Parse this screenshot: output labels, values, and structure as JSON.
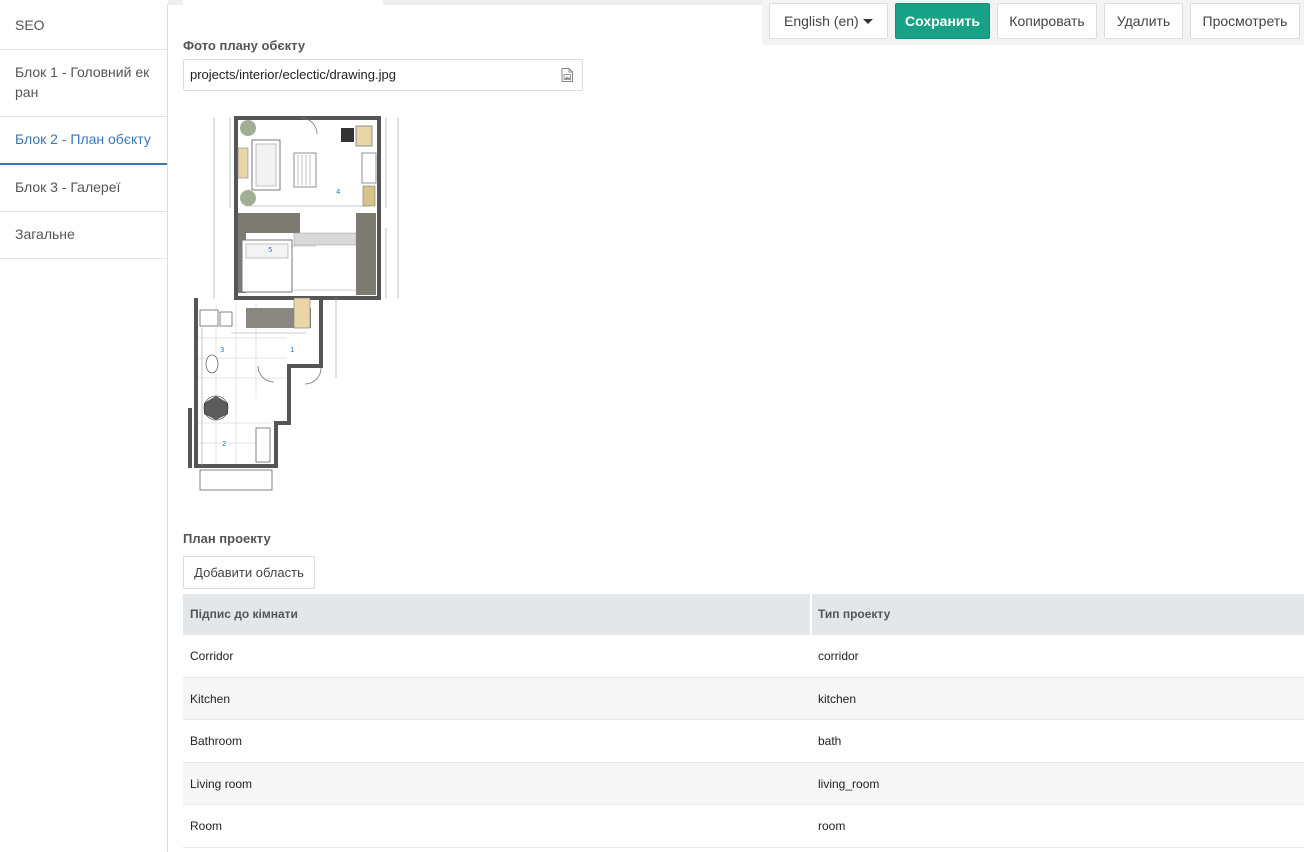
{
  "sidebar": {
    "items": [
      {
        "label": "SEO"
      },
      {
        "label": "Блок 1 - Головний екран"
      },
      {
        "label": "Блок 2 - План обєкту"
      },
      {
        "label": "Блок 3 - Галереї"
      },
      {
        "label": "Загальне"
      }
    ]
  },
  "toolbar": {
    "language": "English (en)",
    "save_label": "Сохранить",
    "copy_label": "Копировать",
    "delete_label": "Удалить",
    "view_label": "Просмотреть"
  },
  "photo": {
    "label": "Фото плану обєкту",
    "file_value": "projects/interior/eclectic/drawing.jpg",
    "file_icon": "image-file-icon"
  },
  "plan": {
    "label": "План проекту",
    "add_label": "Добавити область",
    "table": {
      "headers": [
        "Підпис до кімнати",
        "Тип проекту"
      ],
      "rows": [
        {
          "caption": "Corridor",
          "type": "corridor"
        },
        {
          "caption": "Kitchen",
          "type": "kitchen"
        },
        {
          "caption": "Bathroom",
          "type": "bath"
        },
        {
          "caption": "Living room",
          "type": "living_room"
        },
        {
          "caption": "Room",
          "type": "room"
        }
      ]
    }
  },
  "colors": {
    "accent": "#17a287",
    "active_link": "#3a76b5",
    "header_bg": "#e4e7ea"
  }
}
